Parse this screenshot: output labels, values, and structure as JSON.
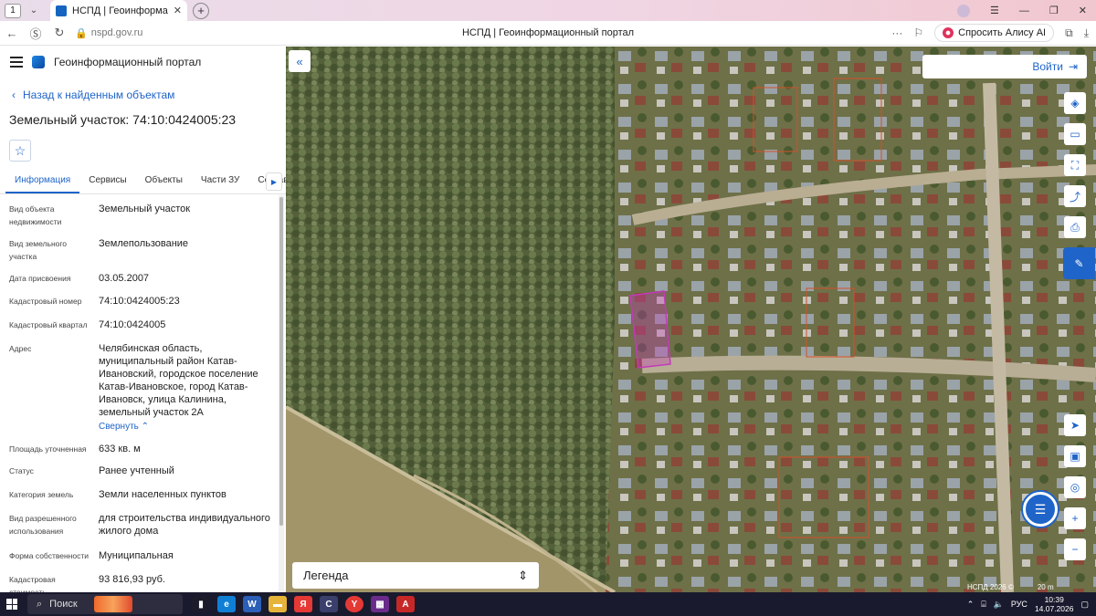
{
  "browser": {
    "tab_count": "1",
    "tab_title": "НСПД | Геоинформационн",
    "url": "nspd.gov.ru",
    "page_title": "НСПД | Геоинформационный портал",
    "alice_label": "Спросить Алису AI"
  },
  "app": {
    "name": "Геоинформационный портал",
    "back_link": "Назад к найденным объектам",
    "object_title": "Земельный участок: 74:10:0424005:23",
    "tabs": [
      {
        "label": "Информация"
      },
      {
        "label": "Сервисы"
      },
      {
        "label": "Объекты"
      },
      {
        "label": "Части ЗУ"
      },
      {
        "label": "Состав"
      }
    ],
    "properties": [
      {
        "label": "Вид объекта недвижимости",
        "value": "Земельный участок"
      },
      {
        "label": "Вид земельного участка",
        "value": "Землепользование"
      },
      {
        "label": "Дата присвоения",
        "value": "03.05.2007"
      },
      {
        "label": "Кадастровый номер",
        "value": "74:10:0424005:23"
      },
      {
        "label": "Кадастровый квартал",
        "value": "74:10:0424005"
      },
      {
        "label": "Адрес",
        "value": "Челябинская область, муниципальный район Катав-Ивановский, городское поселение Катав-Ивановское, город Катав-Ивановск, улица Калинина, земельный участок 2А"
      },
      {
        "label": "Площадь уточненная",
        "value": "633 кв. м"
      },
      {
        "label": "Статус",
        "value": "Ранее учтенный"
      },
      {
        "label": "Категория земель",
        "value": "Земли населенных пунктов"
      },
      {
        "label": "Вид разрешенного использования",
        "value": "для строительства индивидуального жилого дома"
      },
      {
        "label": "Форма собственности",
        "value": "Муниципальная"
      },
      {
        "label": "Кадастровая стоимость",
        "value": "93 816,93 руб."
      }
    ],
    "collapse_label": "Свернуть"
  },
  "map": {
    "login_label": "Войти",
    "legend_label": "Легенда",
    "attribution": "НСПД 2026 ©",
    "scale": "20 m",
    "plot_color": "#c23ab8",
    "accent": "#1f64c8"
  },
  "taskbar": {
    "search_label": "Поиск",
    "lang": "РУС",
    "time": "10:39",
    "date": "14.07.2026"
  }
}
